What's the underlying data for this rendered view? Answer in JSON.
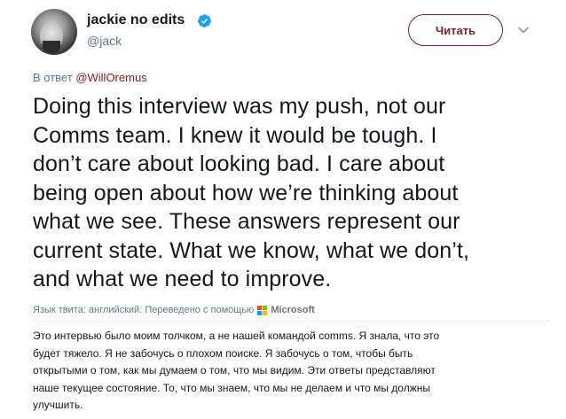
{
  "user": {
    "name": "jackie no edits",
    "handle": "@jack",
    "verified_color": "#1da1f2"
  },
  "follow_button": {
    "label": "Читать",
    "color": "#7b1f2a"
  },
  "reply": {
    "prefix": "В ответ ",
    "mention": "@WillOremus"
  },
  "tweet": {
    "lines": [
      "Doing this interview was my push, not our",
      "Comms team. I knew it would be tough. I",
      "don’t care about looking bad. I care about",
      "being open about how we’re thinking about",
      "what we see. These answers represent our",
      "current state. What we know, what we don’t,",
      "and what we need to improve."
    ]
  },
  "translation": {
    "label": "Язык твита: английский. Переведено с помощью",
    "brand": "Microsoft",
    "lines": [
      "Это интервью было моим толчком, а не нашей командой comms. Я знала, что это",
      "будет тяжело. Я не забочусь о плохом поиске. Я забочусь о том, чтобы быть",
      "открытыми о том, как мы думаем о том, что мы видим. Эти ответы представляют",
      "наше текущее состояние. То, что мы знаем, что мы не делаем и что мы должны",
      "улучшить."
    ]
  }
}
